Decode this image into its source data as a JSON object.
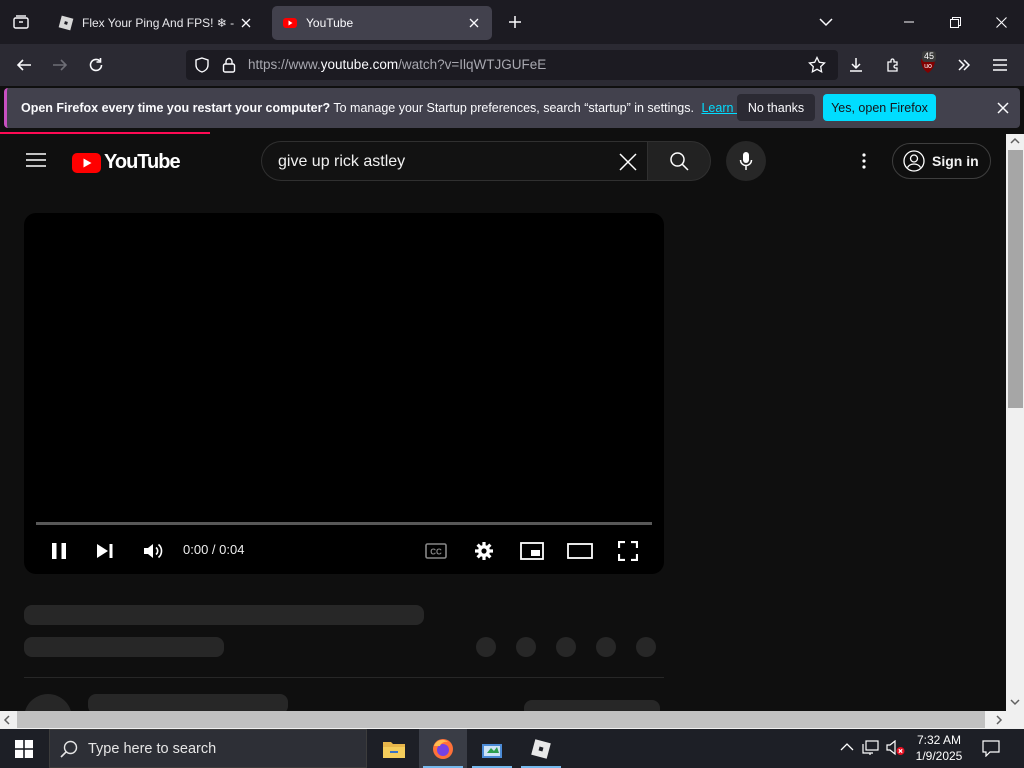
{
  "browser": {
    "tabs": [
      {
        "title": "Flex Your Ping And FPS! ❄ - R",
        "icon": "roblox-favicon",
        "active": false
      },
      {
        "title": "YouTube",
        "icon": "youtube-favicon",
        "active": true
      }
    ],
    "url": {
      "prefix": "https://www.",
      "domain": "youtube.com",
      "path": "/watch?v=IlqWTJGUFeE"
    },
    "extension_badge": "45",
    "notification": {
      "bold": "Open Firefox every time you restart your computer?",
      "text": "To manage your Startup preferences, search “startup” in settings.",
      "link": "Learn more",
      "no_thanks": "No thanks",
      "yes": "Yes, open Firefox"
    },
    "colors": {
      "accent": "#00ddff",
      "tab_active": "#42414d",
      "chrome": "#1c1b22"
    }
  },
  "youtube": {
    "logo_text": "YouTube",
    "search_query": "give up rick astley",
    "sign_in": "Sign in",
    "player": {
      "time": "0:00 / 0:04",
      "progress_fraction": 0.0,
      "state": "playing"
    },
    "colors": {
      "brand": "#ff0000",
      "background": "#0f0f0f"
    }
  },
  "taskbar": {
    "search_placeholder": "Type here to search",
    "apps": [
      "file-explorer",
      "firefox",
      "app-3",
      "roblox"
    ],
    "active_app": "firefox",
    "time": "7:32 AM",
    "date": "1/9/2025"
  }
}
